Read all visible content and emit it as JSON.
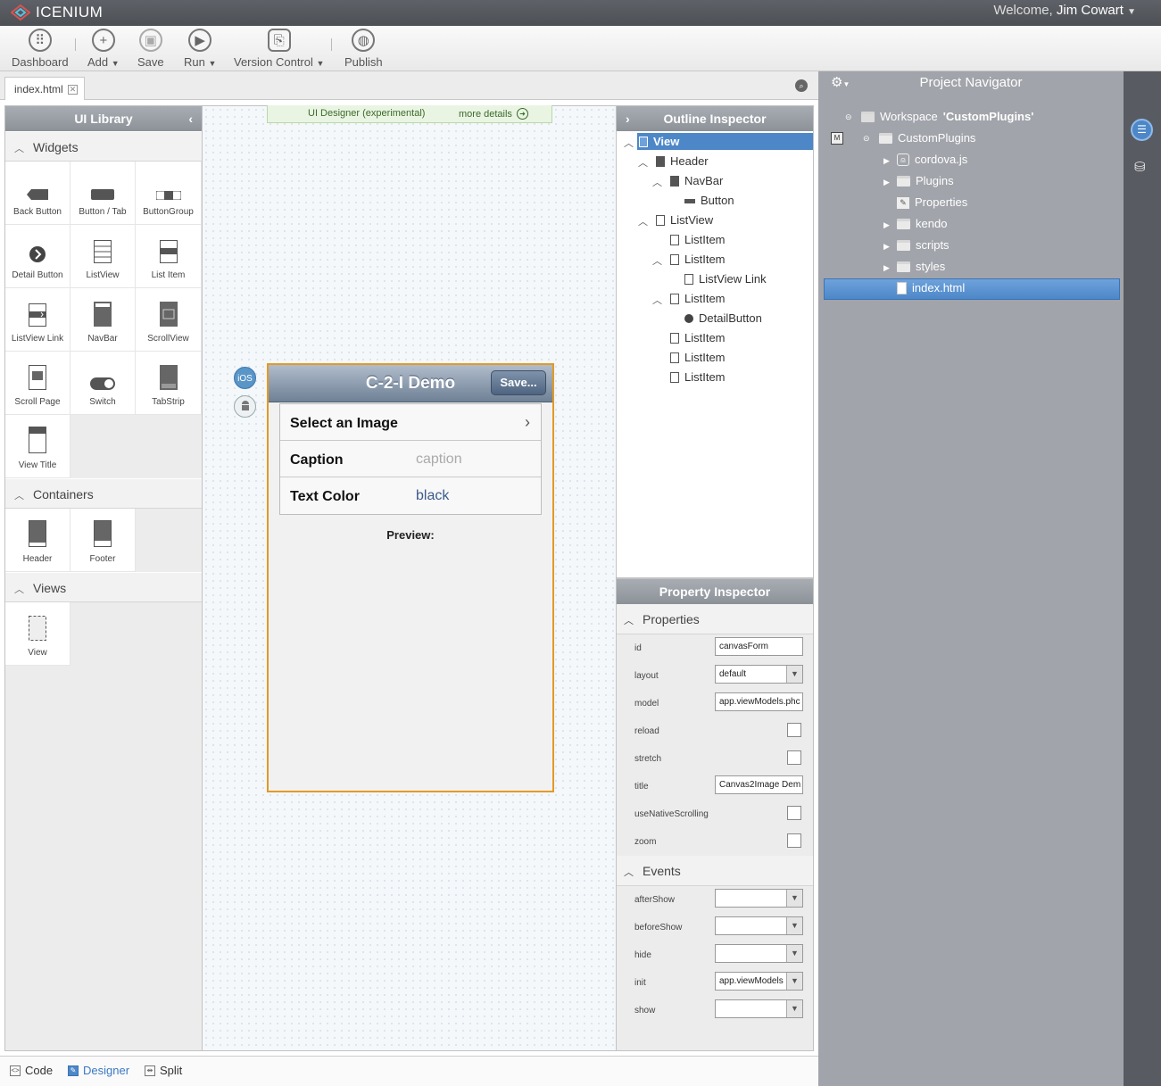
{
  "app": {
    "brand": "ICENIUM",
    "welcome_prefix": "Welcome,",
    "user": "Jim Cowart"
  },
  "toolbar": {
    "dashboard": "Dashboard",
    "add": "Add",
    "save": "Save",
    "run": "Run",
    "version_control": "Version Control",
    "publish": "Publish"
  },
  "tabs": {
    "active": "index.html"
  },
  "ui_library": {
    "title": "UI Library",
    "widgets_title": "Widgets",
    "widgets": [
      "Back Button",
      "Button / Tab",
      "ButtonGroup",
      "Detail Button",
      "ListView",
      "List Item",
      "ListView Link",
      "NavBar",
      "ScrollView",
      "Scroll Page",
      "Switch",
      "TabStrip",
      "View Title"
    ],
    "containers_title": "Containers",
    "containers": [
      "Header",
      "Footer"
    ],
    "views_title": "Views",
    "views": [
      "View"
    ]
  },
  "designer": {
    "banner": "UI Designer (experimental)",
    "more_details": "more details",
    "ios_label": "iOS"
  },
  "device": {
    "title": "C-2-I Demo",
    "save": "Save...",
    "rows": [
      {
        "label": "Select an Image",
        "value": ""
      },
      {
        "label": "Caption",
        "value": "caption"
      },
      {
        "label": "Text Color",
        "value": "black"
      }
    ],
    "preview": "Preview:"
  },
  "outline": {
    "title": "Outline Inspector",
    "items": [
      "View",
      "Header",
      "NavBar",
      "Button",
      "ListView",
      "ListItem",
      "ListItem",
      "ListView Link",
      "ListItem",
      "DetailButton",
      "ListItem",
      "ListItem",
      "ListItem"
    ]
  },
  "property": {
    "title": "Property Inspector",
    "properties_title": "Properties",
    "props": [
      {
        "label": "id",
        "value": "canvasForm"
      },
      {
        "label": "layout",
        "value": "default"
      },
      {
        "label": "model",
        "value": "app.viewModels.phc"
      },
      {
        "label": "reload",
        "value": ""
      },
      {
        "label": "stretch",
        "value": ""
      },
      {
        "label": "title",
        "value": "Canvas2Image Dem"
      },
      {
        "label": "useNativeScrolling",
        "value": ""
      },
      {
        "label": "zoom",
        "value": ""
      }
    ],
    "events_title": "Events",
    "events": [
      {
        "label": "afterShow",
        "value": ""
      },
      {
        "label": "beforeShow",
        "value": ""
      },
      {
        "label": "hide",
        "value": ""
      },
      {
        "label": "init",
        "value": "app.viewModels"
      },
      {
        "label": "show",
        "value": ""
      }
    ]
  },
  "bottom": {
    "code": "Code",
    "designer": "Designer",
    "split": "Split"
  },
  "navigator": {
    "title": "Project Navigator",
    "workspace_prefix": "Workspace",
    "workspace_name": "'CustomPlugins'",
    "project": "CustomPlugins",
    "badge": "M",
    "items": [
      "cordova.js",
      "Plugins",
      "Properties",
      "kendo",
      "scripts",
      "styles",
      "index.html"
    ]
  },
  "colors": {
    "accent": "#4d87c8",
    "device_border": "#e39a26",
    "nav_bg": "#a1a4aa"
  }
}
